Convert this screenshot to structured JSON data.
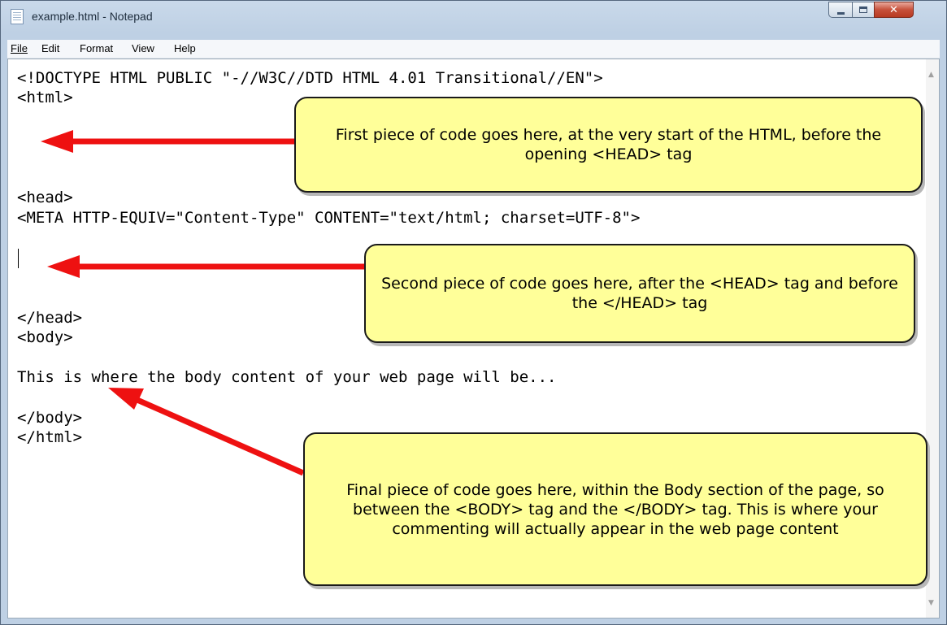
{
  "window": {
    "title": "example.html - Notepad"
  },
  "menu": {
    "file": "File",
    "edit": "Edit",
    "format": "Format",
    "view": "View",
    "help": "Help"
  },
  "editor": {
    "lines": [
      "<!DOCTYPE HTML PUBLIC \"-//W3C//DTD HTML 4.01 Transitional//EN\">",
      "<html>",
      "<head>",
      "<META HTTP-EQUIV=\"Content-Type\" CONTENT=\"text/html; charset=UTF-8\">",
      "</head>",
      "<body>",
      "This is where the body content of your web page will be...",
      "</body>",
      "</html>"
    ]
  },
  "callouts": {
    "first": "First piece of code goes here, at the very start of the HTML, before the opening <HEAD> tag",
    "second": "Second piece of code goes here, after the <HEAD> tag and before the </HEAD> tag",
    "final": "Final piece of code goes here, within the Body section of the page, so between the <BODY> tag and the </BODY> tag. This is where your commenting will actually appear in the web page content"
  },
  "colors": {
    "arrow": "#ee1111",
    "callout_fill": "#ffff99"
  },
  "icons": [
    "notepad-icon",
    "minimize-icon",
    "maximize-icon",
    "close-icon",
    "scroll-up-icon",
    "scroll-down-icon"
  ]
}
